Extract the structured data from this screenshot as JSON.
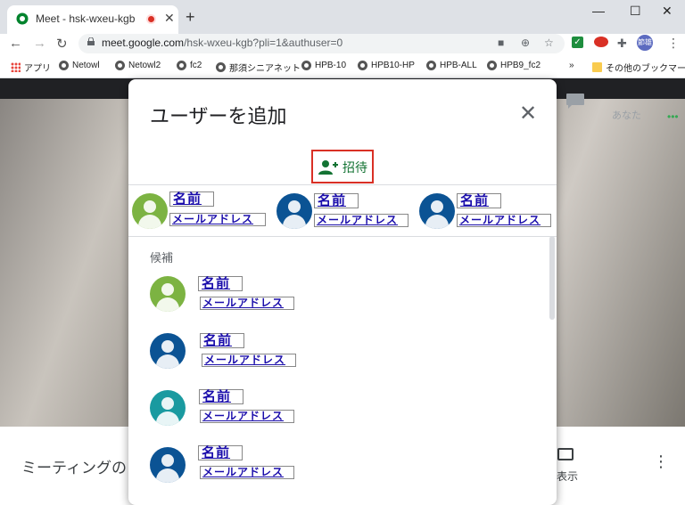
{
  "browser": {
    "tab_title": "Meet - hsk-wxeu-kgb",
    "tab_close": "✕",
    "new_tab": "+",
    "window_controls": [
      "—",
      "☐",
      "✕"
    ],
    "url_host": "meet.google.com",
    "url_path": "/hsk-wxeu-kgb?pli=1&authuser=0",
    "profile_label": "節雄",
    "bookmarks": [
      "アプリ",
      "Netowl",
      "Netowl2",
      "fc2",
      "那須シニアネット",
      "HPB-10",
      "HPB10-HP",
      "HPB-ALL",
      "HPB9_fc2"
    ],
    "bookmarks_more": "»",
    "other_bookmarks": "その他のブックマーク"
  },
  "meet": {
    "you_label": "あなた",
    "meeting_title": "ミーティングの",
    "present_label": "く表示"
  },
  "dialog": {
    "title": "ユーザーを追加",
    "invite_label": "招待",
    "selected": [
      {
        "name": "名前",
        "email": "メールアドレス",
        "color": "#7cb342"
      },
      {
        "name": "名前",
        "email": "メールアドレス",
        "color": "#0b5394"
      },
      {
        "name": "名前",
        "email": "メールアドレス",
        "color": "#0b5394"
      }
    ],
    "candidates_label": "候補",
    "candidates": [
      {
        "name": "名前",
        "email": "メールアドレス",
        "color": "#7cb342"
      },
      {
        "name": "名前",
        "email": "メールアドレス",
        "color": "#0b5394"
      },
      {
        "name": "名前",
        "email": "メールアドレス",
        "color": "#1a9aa0"
      },
      {
        "name": "名前",
        "email": "メールアドレス",
        "color": "#0b5394"
      }
    ]
  },
  "colors": {
    "accent_green": "#137333",
    "highlight_red": "#d93025"
  }
}
